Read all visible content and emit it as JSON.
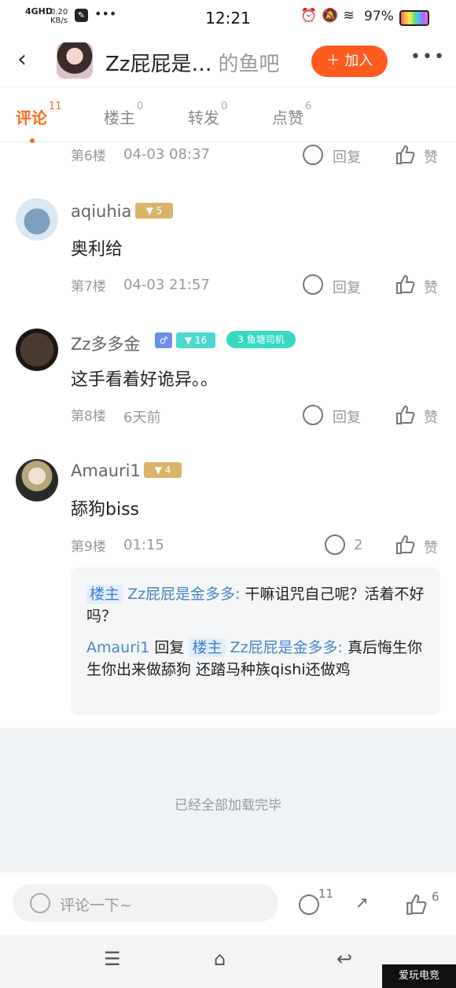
{
  "status_bar": {
    "network": "4GHD",
    "speed_value": "0.20",
    "speed_unit": "KB/s",
    "time": "12:21",
    "battery": "97%"
  },
  "header": {
    "title": "Zz屁屁是…",
    "subtitle": "的鱼吧",
    "join_label": "＋ 加入"
  },
  "tabs": [
    {
      "label": "评论",
      "count": "11"
    },
    {
      "label": "楼主",
      "count": "0"
    },
    {
      "label": "转发",
      "count": "0"
    },
    {
      "label": "点赞",
      "count": "6"
    }
  ],
  "actions": {
    "reply": "回复",
    "like": "赞"
  },
  "partial_row": {
    "floor": "第6楼",
    "time": "04-03 08:37"
  },
  "comments": [
    {
      "user": "aqiuhia",
      "level": "5",
      "text": "奥利给",
      "floor": "第7楼",
      "time": "04-03 21:57"
    },
    {
      "user": "Zz多多金",
      "gender": "♂",
      "level": "16",
      "badge_num": "3",
      "badge_label": "鱼塘司机",
      "text": "这手看着好诡异。。",
      "floor": "第8楼",
      "time": "6天前"
    },
    {
      "user": "Amauri1",
      "level": "4",
      "text": "舔狗biss",
      "floor": "第9楼",
      "time": "01:15",
      "reply_count": "2"
    }
  ],
  "replies": {
    "r1_tag": "楼主",
    "r1_name": "Zz屁屁是金多多:",
    "r1_text": "干嘛诅咒自己呢？活着不好吗？",
    "r2_name": "Amauri1",
    "r2_mid": "回复",
    "r2_tag": "楼主",
    "r2_target": "Zz屁屁是金多多:",
    "r2_text": "真后悔生你  生你出来做舔狗  还踏马种族qishi还做鸡"
  },
  "end_text": "已经全部加载完毕",
  "bottom_bar": {
    "placeholder": "评论一下~",
    "comment_count": "11",
    "like_count": "6"
  },
  "watermark": "爱玩电竞"
}
